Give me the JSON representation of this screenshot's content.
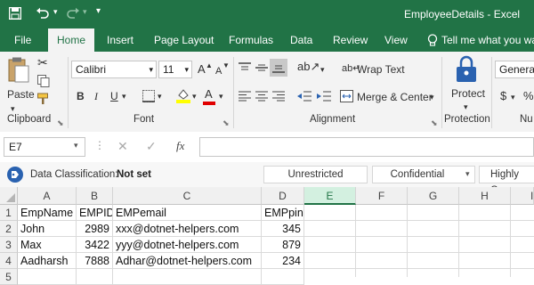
{
  "title_bar": {
    "title": "EmployeeDetails - Excel"
  },
  "tabs": [
    "File",
    "Home",
    "Insert",
    "Page Layout",
    "Formulas",
    "Data",
    "Review",
    "View"
  ],
  "tell_me": "Tell me what you want",
  "ribbon": {
    "clipboard": {
      "paste": "Paste",
      "label": "Clipboard"
    },
    "font": {
      "name": "Calibri",
      "size": "11",
      "grow": "A",
      "shrink": "A",
      "bold": "B",
      "italic": "I",
      "underline": "U",
      "label": "Font"
    },
    "alignment": {
      "wrap_text": "Wrap Text",
      "merge_center": "Merge & Center",
      "label": "Alignment"
    },
    "protection": {
      "protect": "Protect",
      "label": "Protection"
    },
    "number": {
      "format": "General",
      "currency": "$",
      "percent": "%",
      "label": "Nu"
    }
  },
  "formula_bar": {
    "name_box": "E7",
    "fx": "fx",
    "value": ""
  },
  "info_bar": {
    "label": "Data Classification:",
    "status": "Not set",
    "options": [
      "Unrestricted",
      "Confidential",
      "Highly Cor"
    ]
  },
  "sheet": {
    "columns": [
      "A",
      "B",
      "C",
      "D",
      "E",
      "F",
      "G",
      "H",
      "I"
    ],
    "selected_column": "E",
    "row_numbers": [
      "1",
      "2",
      "3",
      "4",
      "5"
    ],
    "rows": [
      [
        "EmpName",
        "EMPID",
        "EMPemail",
        "EMPpin"
      ],
      [
        "John",
        "2989",
        "xxx@dotnet-helpers.com",
        "345"
      ],
      [
        "Max",
        "3422",
        "yyy@dotnet-helpers.com",
        "879"
      ],
      [
        "Aadharsh",
        "7888",
        "Adhar@dotnet-helpers.com",
        "234"
      ],
      [
        "",
        "",
        "",
        ""
      ]
    ]
  },
  "colors": {
    "brand": "#217346",
    "ribbon_bg": "#f3f3f3",
    "font_color_bar": "#e00000",
    "highlight_bar": "#ffff00"
  }
}
